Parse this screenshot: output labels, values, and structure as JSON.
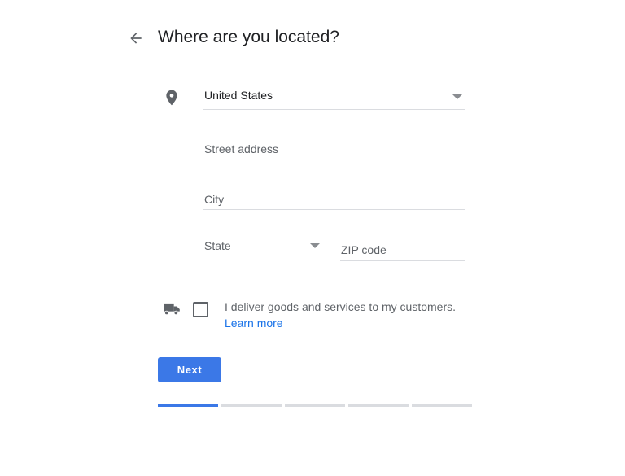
{
  "header": {
    "back_icon": "arrow-left-icon",
    "title": "Where are you located?"
  },
  "form": {
    "location_icon": "map-pin-icon",
    "country": {
      "value": "United States",
      "icon": "dropdown-caret-icon"
    },
    "street": {
      "placeholder": "Street address"
    },
    "city": {
      "placeholder": "City"
    },
    "state": {
      "placeholder": "State",
      "icon": "dropdown-caret-icon"
    },
    "zip": {
      "placeholder": "ZIP code"
    }
  },
  "delivery": {
    "icon": "truck-icon",
    "checked": false,
    "label": "I deliver goods and services to my customers.",
    "learn_more": "Learn more"
  },
  "actions": {
    "next_label": "Next",
    "accent_color": "#3b78e7"
  },
  "progress": {
    "total_steps": 5,
    "current_step": 1
  }
}
